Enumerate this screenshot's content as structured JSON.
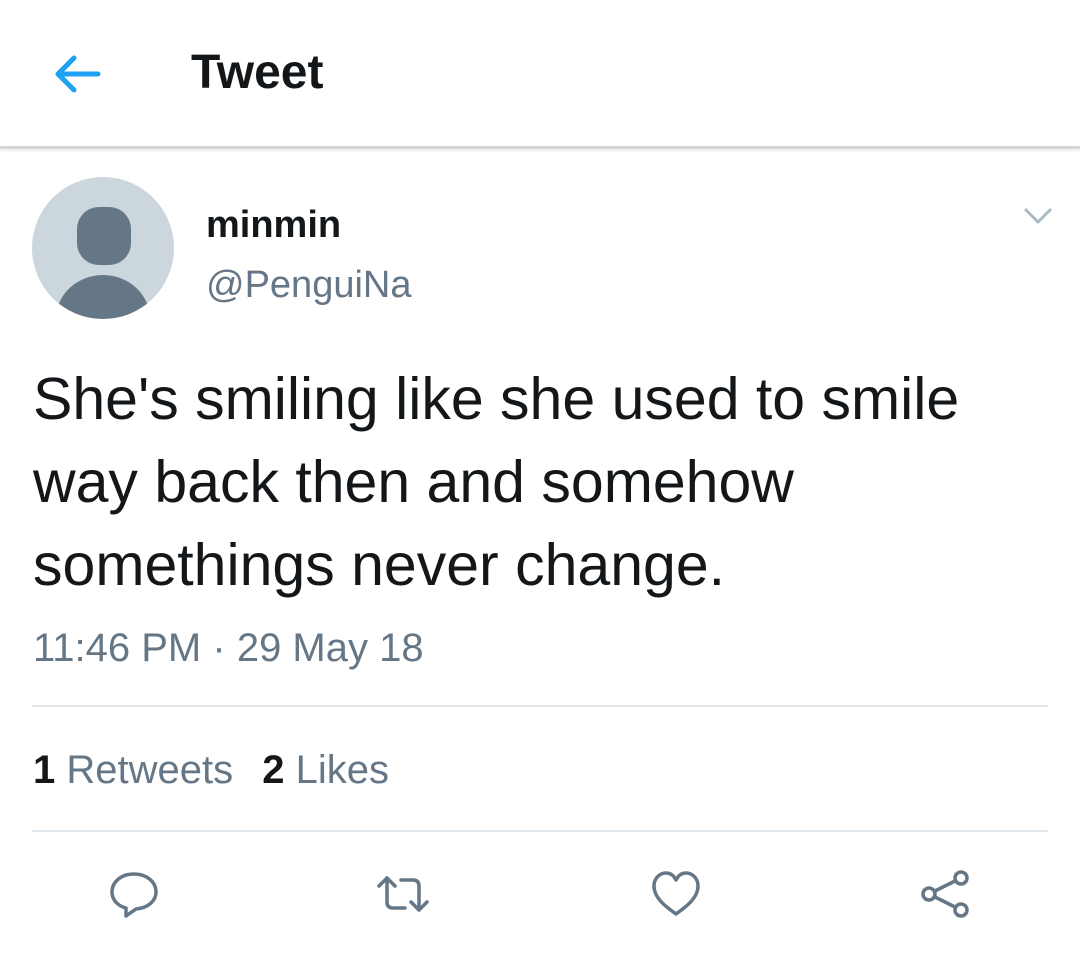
{
  "header": {
    "title": "Tweet",
    "back_icon": "arrow-left-icon",
    "accent_color": "#1da1f2"
  },
  "tweet": {
    "author": {
      "display_name": "minmin",
      "handle": "@PenguiNa",
      "avatar_icon": "default-avatar-icon"
    },
    "text": "She's smiling like she used to smile way back then and somehow somethings never change.",
    "time": "11:46 PM",
    "separator": "·",
    "date": "29 May 18",
    "stats": {
      "retweets_count": "1",
      "retweets_label": "Retweets",
      "likes_count": "2",
      "likes_label": "Likes"
    },
    "actions": [
      "reply-icon",
      "retweet-icon",
      "like-icon",
      "share-icon"
    ]
  },
  "colors": {
    "text_primary": "#14171a",
    "text_secondary": "#657786",
    "icon_gray": "#657786",
    "divider": "#e1e8ed"
  }
}
